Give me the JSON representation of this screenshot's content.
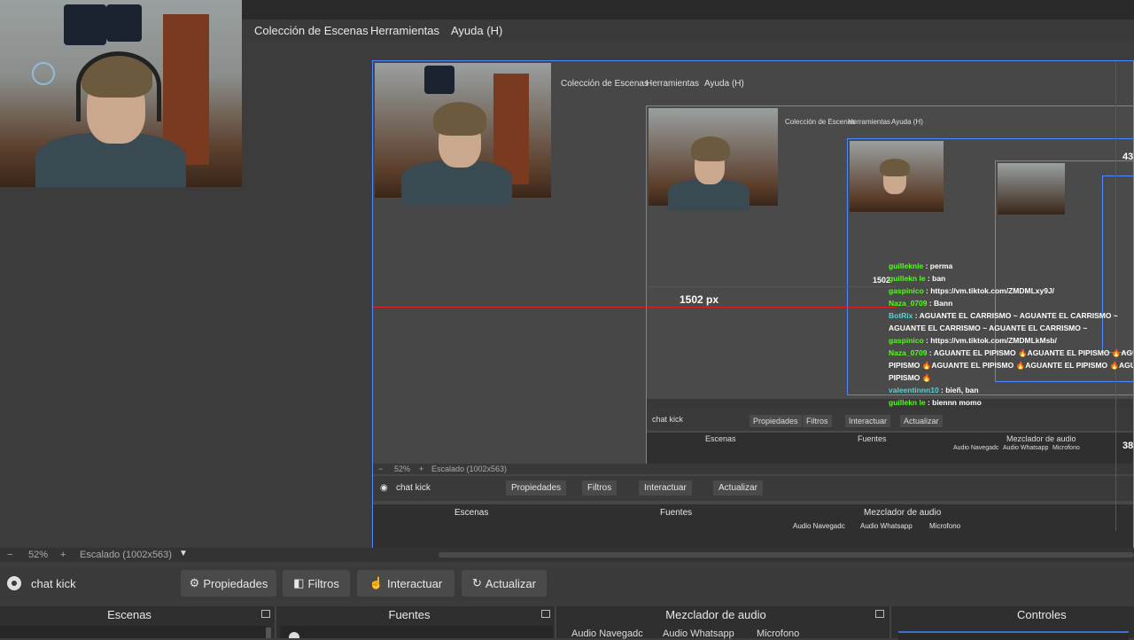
{
  "menu": {
    "items": [
      "Colección de Escenas",
      "Herramientas",
      "Ayuda (H)"
    ]
  },
  "preview": {
    "measure_label": "1502 px",
    "nested_measure_label": "1502",
    "edge_numbers": [
      "43",
      "38"
    ],
    "inner_zoom": "52%",
    "inner_scale": "Escalado (1002x563)",
    "inner_source": "chat kick",
    "inner_buttons": [
      "Propiedades",
      "Filtros",
      "Interactuar",
      "Actualizar"
    ],
    "inner_docks": [
      "Escenas",
      "Fuentes",
      "Mezclador de audio"
    ],
    "inner_mixer": [
      "Audio Navegadc",
      "Audio Whatsapp",
      "Microfono"
    ],
    "nested_zoom": "52%",
    "nested_scale": "Escalado (1002x563)",
    "nested_source": "chat kick",
    "nested_buttons": [
      "Propiedades",
      "Filtros",
      "Interactuar",
      "Actualizar"
    ],
    "nested_docks": [
      "Escenas",
      "Fuentes",
      "Mezclador de audio"
    ],
    "nested_mixer": [
      "Audio Navegadc",
      "Audio Whatsapp",
      "Microfono"
    ]
  },
  "chat": [
    {
      "user": "guilleknle",
      "msg": " : perma",
      "color": "#53fc18"
    },
    {
      "user": "guillekn le",
      "msg": " : ban",
      "color": "#53fc18"
    },
    {
      "user": "gaspinico",
      "msg": " : https://vm.tiktok.com/ZMDMLxy9J/",
      "color": "#53fc18"
    },
    {
      "user": "Naza_0709",
      "msg": " : Bann",
      "color": "#53fc18"
    },
    {
      "user": "BotRix",
      "msg": " : AGUANTE EL CARRISMO ~ AGUANTE EL CARRISMO ~",
      "color": "#5cd0d0"
    },
    {
      "user": "",
      "msg": "AGUANTE EL CARRISMO ~ AGUANTE EL CARRISMO ~",
      "color": "#ffffff"
    },
    {
      "user": "gaspinico",
      "msg": " : https://vm.tiktok.com/ZMDMLkMsb/",
      "color": "#53fc18"
    },
    {
      "user": "Naza_0709",
      "msg": " : AGUANTE EL PIPISMO 🔥AGUANTE EL PIPISMO 🔥AGUANTE",
      "color": "#53fc18"
    },
    {
      "user": "",
      "msg": "PIPISMO 🔥AGUANTE EL PIPISMO 🔥AGUANTE EL PIPISMO 🔥AGUANTE",
      "color": "#ffffff"
    },
    {
      "user": "",
      "msg": "PIPISMO 🔥",
      "color": "#ffffff"
    },
    {
      "user": "valeentinnn10",
      "msg": " : bieñ, ban",
      "color": "#5cd0d0"
    },
    {
      "user": "guillekn le",
      "msg": " : biennn momo",
      "color": "#53fc18"
    }
  ],
  "mini_chat": [
    {
      "user": "guillekn le",
      "msg": " : perma"
    },
    {
      "user": "guillekn le",
      "msg": " : ban"
    },
    {
      "user": "gaspinico",
      "msg": " : https://vm.tiktok.com/ZMDMLxy"
    },
    {
      "user": "",
      "msg": "AGUANTE EL CARRISMO ~ AGUANTE EL CA"
    },
    {
      "user": "",
      "msg": "AGUANTE EL CARRISMO"
    }
  ],
  "zoombar": {
    "minus": "−",
    "zoom": "52%",
    "plus": "+",
    "scale": "Escalado (1002x563)"
  },
  "controls": {
    "source": "chat kick",
    "propiedades": "Propiedades",
    "filtros": "Filtros",
    "interactuar": "Interactuar",
    "actualizar": "Actualizar"
  },
  "docks": {
    "escenas": "Escenas",
    "fuentes": "Fuentes",
    "mezclador": "Mezclador de audio",
    "controles": "Controles"
  },
  "mixer": {
    "ch1": "Audio Navegadc",
    "ch2": "Audio Whatsapp",
    "ch3": "Microfono"
  },
  "colors": {
    "accent_blue": "#4d88ff",
    "guide_red": "#e02020",
    "kick_green": "#53fc18"
  }
}
